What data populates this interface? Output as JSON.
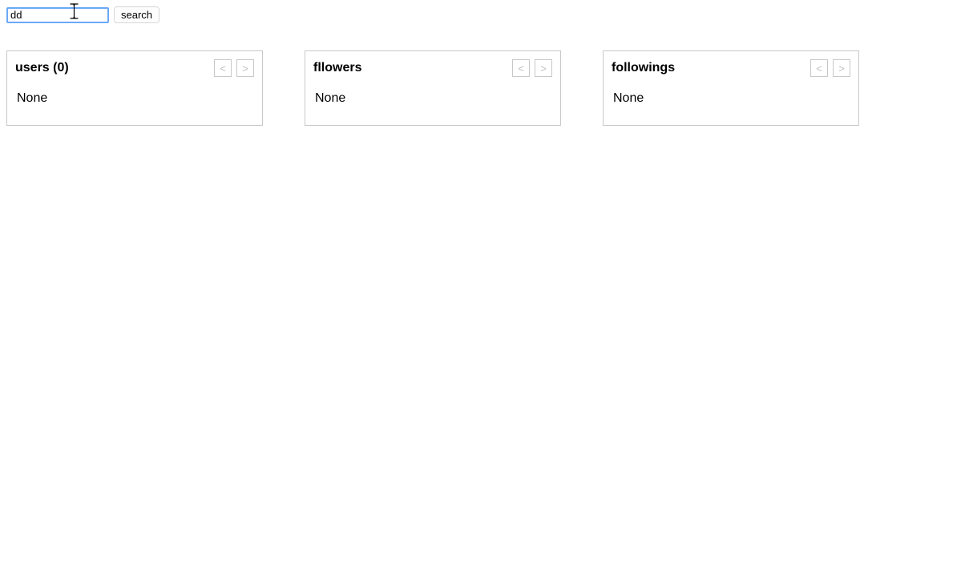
{
  "search": {
    "value": "dd",
    "button_label": "search"
  },
  "panels": [
    {
      "title": "users (0)",
      "body": "None",
      "prev": "<",
      "next": ">"
    },
    {
      "title": "fllowers",
      "body": "None",
      "prev": "<",
      "next": ">"
    },
    {
      "title": "followings",
      "body": "None",
      "prev": "<",
      "next": ">"
    }
  ]
}
